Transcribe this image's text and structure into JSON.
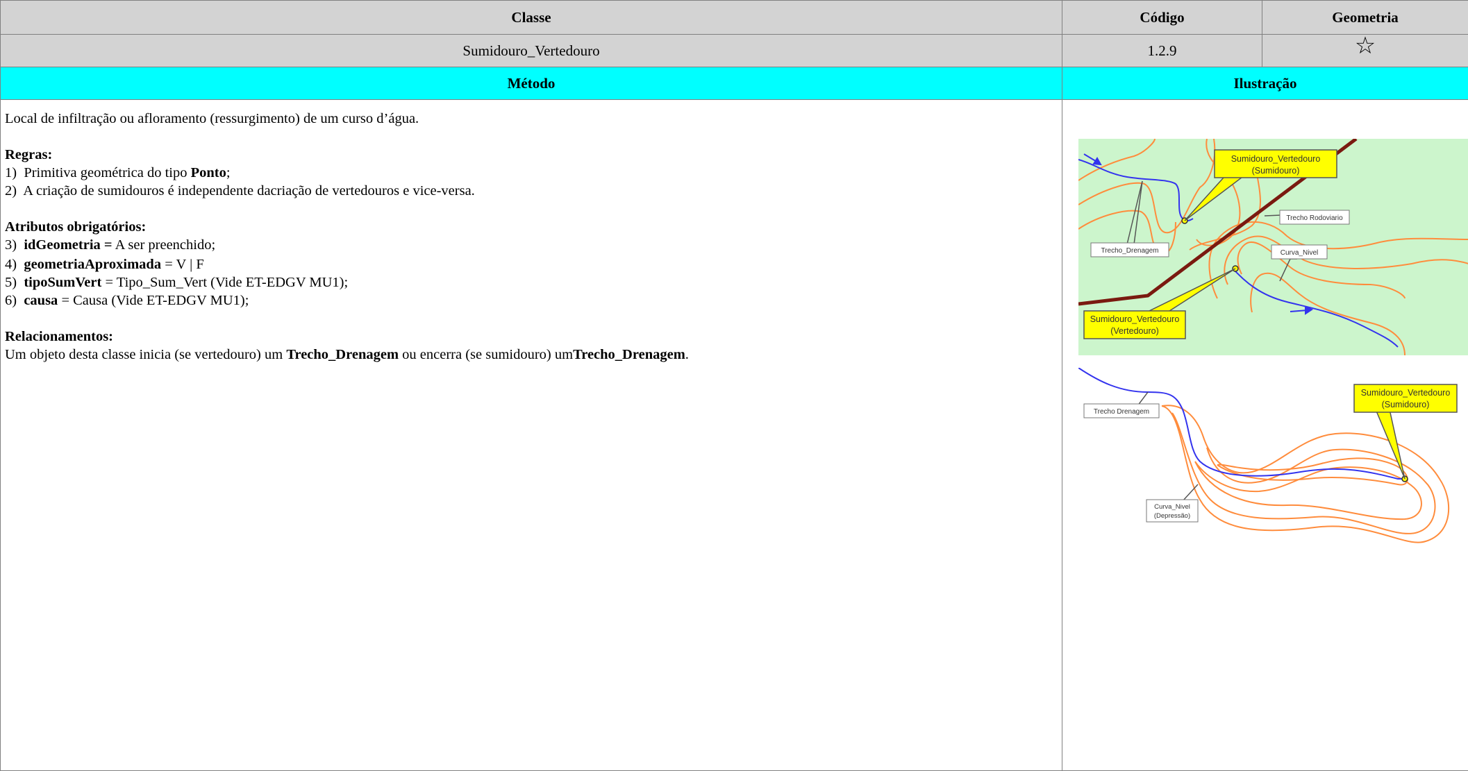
{
  "header": {
    "classe_label": "Classe",
    "codigo_label": "Código",
    "geometria_label": "Geometria"
  },
  "values": {
    "classe": "Sumidouro_Vertedouro",
    "codigo": "1.2.9",
    "geometry_icon": "star-outline-icon",
    "geometry_glyph": "☆"
  },
  "section": {
    "metodo_label": "Método",
    "ilustracao_label": "Ilustração"
  },
  "method": {
    "description": "Local de infiltração ou afloramento (ressurgimento) de um curso d’água.",
    "regras_title": "Regras:",
    "regras": [
      {
        "num": "1)",
        "pre": "Primitiva geométrica do tipo ",
        "bold": "Ponto",
        "post": ";"
      },
      {
        "num": "2)",
        "pre": "A criação de sumidouros é independente dacriação de vertedouros e vice-versa.",
        "bold": "",
        "post": ""
      }
    ],
    "atributos_title": "Atributos obrigatórios:",
    "atributos": [
      {
        "num": "3)",
        "bold": "idGeometria =",
        "post": " A ser preenchido;"
      },
      {
        "num": "4)",
        "bold": "geometriaAproximada",
        "post": " = V | F"
      },
      {
        "num": "5)",
        "bold": "tipoSumVert",
        "post": " = Tipo_Sum_Vert  (Vide ET-EDGV MU1);"
      },
      {
        "num": "6)",
        "bold": "causa",
        "post": " = Causa (Vide ET-EDGV MU1);"
      }
    ],
    "relacionamentos_title": "Relacionamentos:",
    "relacionamentos": {
      "t1": "Um objeto desta classe inicia (se vertedouro) um ",
      "b1": "Trecho_Drenagem",
      "t2": " ou encerra (se sumidouro) um",
      "b2": "Trecho_Drenagem",
      "t3": "."
    }
  },
  "illustration1": {
    "bg_color": "#ccf5cc",
    "callout_sumidouro_line1": "Sumidouro_Vertedouro",
    "callout_sumidouro_line2": "(Sumidouro)",
    "label_rodoviario": "Trecho Rodoviario",
    "label_drenagem": "Trecho_Drenagem",
    "label_curva": "Curva_Nivel",
    "callout_vertedouro_line1": "Sumidouro_Vertedouro",
    "callout_vertedouro_line2": "(Vertedouro)"
  },
  "illustration2": {
    "label_drenagem": "Trecho Drenagem",
    "callout_line1": "Sumidouro_Vertedouro",
    "callout_line2": "(Sumidouro)",
    "label_curva_line1": "Curva_Nivel",
    "label_curva_line2": "(Depressão)"
  },
  "colors": {
    "header_gray": "#d3d3d3",
    "section_cyan": "#00ffff",
    "drainage_blue": "#3333ee",
    "contour_orange": "#ff8c3c",
    "road_brown": "#7a1a10",
    "callout_yellow": "#ffff00"
  }
}
